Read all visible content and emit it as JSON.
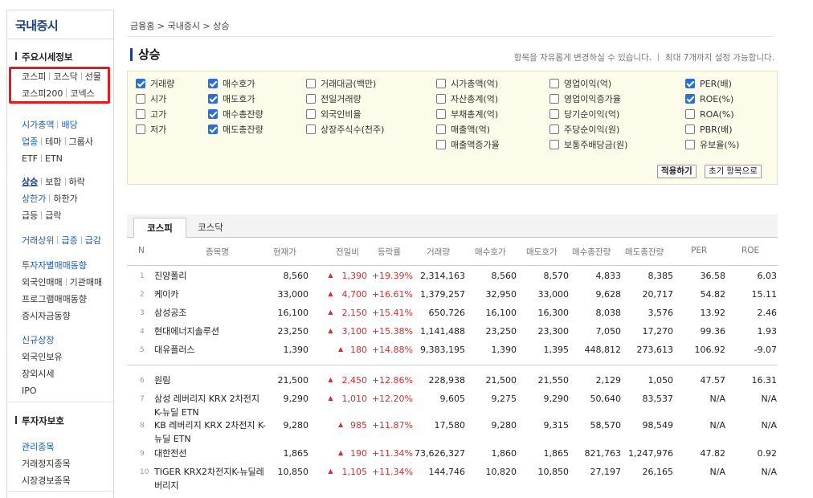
{
  "sidebar": {
    "title": "국내증시",
    "section1": "주요시세정보",
    "g1": [
      [
        "코스피",
        "코스닥",
        "선물"
      ],
      [
        "코스피200",
        "코넥스"
      ]
    ],
    "g2": [
      [
        "시가총액",
        "배당"
      ],
      [
        "업종",
        "테마",
        "그룹사"
      ],
      [
        "ETF",
        "ETN"
      ]
    ],
    "g3": [
      [
        "상승",
        "보합",
        "하락"
      ],
      [
        "상한가",
        "하한가"
      ],
      [
        "급등",
        "급락"
      ]
    ],
    "g4": [
      [
        "거래상위",
        "급증",
        "급감"
      ]
    ],
    "g5": [
      [
        "투자자별매매동향"
      ],
      [
        "외국인매매",
        "기관매매"
      ],
      [
        "프로그램매매동향"
      ],
      [
        "증시자금동향"
      ]
    ],
    "g6": [
      [
        "신규상장"
      ],
      [
        "외국인보유"
      ],
      [
        "장외시세"
      ],
      [
        "IPO"
      ]
    ],
    "section2": "투자자보호",
    "g7": [
      [
        "관리종목"
      ],
      [
        "거래정지종목"
      ],
      [
        "시장경보종목"
      ]
    ]
  },
  "breadcrumb": "금융홈 > 국내증시 > 상승",
  "page_title": "상승",
  "hint": {
    "a": "항목을 자유롭게 변경하실 수 있습니다.",
    "b": "최대 7개까지 설정 가능합니다."
  },
  "options": [
    [
      {
        "label": "거래량",
        "on": true
      },
      {
        "label": "시가",
        "on": false
      },
      {
        "label": "고가",
        "on": false
      },
      {
        "label": "저가",
        "on": false
      }
    ],
    [
      {
        "label": "매수호가",
        "on": true
      },
      {
        "label": "매도호가",
        "on": true
      },
      {
        "label": "매수총잔량",
        "on": true
      },
      {
        "label": "매도총잔량",
        "on": true
      }
    ],
    [
      {
        "label": "거래대금(백만)",
        "on": false
      },
      {
        "label": "전일거래량",
        "on": false
      },
      {
        "label": "외국인비율",
        "on": false
      },
      {
        "label": "상장주식수(천주)",
        "on": false
      }
    ],
    [
      {
        "label": "시가총액(억)",
        "on": false
      },
      {
        "label": "자산총계(억)",
        "on": false
      },
      {
        "label": "부채총계(억)",
        "on": false
      },
      {
        "label": "매출액(억)",
        "on": false
      },
      {
        "label": "매출액증가율",
        "on": false
      }
    ],
    [
      {
        "label": "영업이익(억)",
        "on": false
      },
      {
        "label": "영업이익증가율",
        "on": false
      },
      {
        "label": "당기순이익(억)",
        "on": false
      },
      {
        "label": "주당순이익(원)",
        "on": false
      },
      {
        "label": "보통주배당금(원)",
        "on": false
      }
    ],
    [
      {
        "label": "PER(배)",
        "on": true
      },
      {
        "label": "ROE(%)",
        "on": true
      },
      {
        "label": "ROA(%)",
        "on": false
      },
      {
        "label": "PBR(배)",
        "on": false
      },
      {
        "label": "유보율(%)",
        "on": false
      }
    ]
  ],
  "buttons": {
    "apply": "적용하기",
    "reset": "초기 항목으로"
  },
  "tabs": [
    "코스피",
    "코스닥"
  ],
  "headers": [
    "N",
    "종목명",
    "현재가",
    "전일비",
    "등락률",
    "거래량",
    "매수호가",
    "매도호가",
    "매수총잔량",
    "매도총잔량",
    "PER",
    "ROE"
  ],
  "rows": [
    [
      "1",
      "진양폴리",
      "8,560",
      "1,390",
      "+19.39%",
      "2,314,163",
      "8,560",
      "8,570",
      "4,833",
      "8,385",
      "36.58",
      "6.03"
    ],
    [
      "2",
      "케이카",
      "33,000",
      "4,700",
      "+16.61%",
      "1,379,257",
      "32,950",
      "33,000",
      "9,628",
      "20,717",
      "54.82",
      "15.11"
    ],
    [
      "3",
      "삼성공조",
      "16,100",
      "2,150",
      "+15.41%",
      "650,726",
      "16,100",
      "16,300",
      "8,038",
      "3,576",
      "13.92",
      "2.46"
    ],
    [
      "4",
      "현대에너지솔루션",
      "23,250",
      "3,100",
      "+15.38%",
      "1,141,488",
      "23,250",
      "23,300",
      "7,050",
      "17,270",
      "99.36",
      "1.93"
    ],
    [
      "5",
      "대유플러스",
      "1,390",
      "180",
      "+14.88%",
      "9,383,195",
      "1,390",
      "1,395",
      "448,812",
      "273,613",
      "106.92",
      "-9.07"
    ],
    [
      "6",
      "원림",
      "21,500",
      "2,450",
      "+12.86%",
      "228,938",
      "21,500",
      "21,550",
      "2,129",
      "1,050",
      "47.57",
      "16.31"
    ],
    [
      "7",
      "삼성 레버리지 KRX 2차전지 K-뉴딜 ETN",
      "9,290",
      "1,010",
      "+12.20%",
      "9,605",
      "9,275",
      "9,290",
      "50,640",
      "83,537",
      "N/A",
      "N/A"
    ],
    [
      "8",
      "KB 레버리지 KRX 2차전지 K-뉴딜 ETN",
      "9,280",
      "985",
      "+11.87%",
      "17,580",
      "9,280",
      "9,315",
      "58,570",
      "98,549",
      "N/A",
      "N/A"
    ],
    [
      "9",
      "대한전선",
      "1,865",
      "190",
      "+11.34%",
      "73,626,327",
      "1,860",
      "1,865",
      "821,763",
      "1,247,976",
      "47.82",
      "0.92"
    ],
    [
      "10",
      "TIGER KRX2차전지K-뉴딜레버리지",
      "10,850",
      "1,105",
      "+11.34%",
      "144,746",
      "10,820",
      "10,850",
      "27,197",
      "26,165",
      "N/A",
      "N/A"
    ]
  ],
  "colors": {
    "accent": "#1a3f87",
    "up": "#d32f2f",
    "highlight": "#e8191c"
  }
}
